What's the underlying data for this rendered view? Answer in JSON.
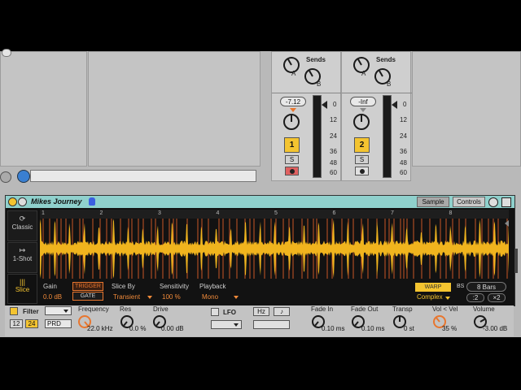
{
  "session": {
    "left_small_button": "",
    "bottom_field": ""
  },
  "mixer": {
    "tracks": [
      {
        "sends_label": "Sends",
        "send_a": "A",
        "send_b": "B",
        "volume": "-7.12",
        "number": "1",
        "solo": "S",
        "color": "#f4c430"
      },
      {
        "sends_label": "Sends",
        "send_a": "A",
        "send_b": "B",
        "volume": "-Inf",
        "number": "2",
        "solo": "S",
        "color": "#f4c430"
      }
    ],
    "db_scale": [
      "0",
      "12",
      "24",
      "36",
      "48",
      "60"
    ]
  },
  "clip": {
    "title": "Mikes Journey",
    "tabs": {
      "sample": "Sample",
      "controls": "Controls"
    },
    "modes": {
      "classic": "Classic",
      "one_shot": "1-Shot",
      "slice": "Slice"
    },
    "ruler": [
      "1",
      "2",
      "3",
      "4",
      "5",
      "6",
      "7",
      "8"
    ],
    "gain_label": "Gain",
    "gain_value": "0.0 dB",
    "trigger": "TRIGGER",
    "gate": "GATE",
    "slice_by_label": "Slice By",
    "slice_by_value": "Transient",
    "sensitivity_label": "Sensitivity",
    "sensitivity_value": "100 %",
    "playback_label": "Playback",
    "playback_value": "Mono",
    "warp": "WARP",
    "bs_label": "BS",
    "bars": "8 Bars",
    "warp_mode": "Complex",
    "half": ":2",
    "double": "×2",
    "colors": {
      "header": "#8fd0cc",
      "waveform": "#f0b41e",
      "markers": "#e8642a",
      "accent": "#f08a3a"
    }
  },
  "controls": {
    "filter_label": "Filter",
    "filter_slopes": [
      "12",
      "24"
    ],
    "filter_type": "PRD",
    "frequency_label": "Frequency",
    "frequency_value": "22.0 kHz",
    "res_label": "Res",
    "res_value": "0.0 %",
    "drive_label": "Drive",
    "drive_value": "0.00 dB",
    "lfo_label": "LFO",
    "hz_label": "Hz",
    "note_symbol": "♪",
    "fade_in_label": "Fade In",
    "fade_in_value": "0.10 ms",
    "fade_out_label": "Fade Out",
    "fade_out_value": "0.10 ms",
    "transp_label": "Transp",
    "transp_value": "0 st",
    "vol_vel_label": "Vol < Vel",
    "vol_vel_value": "35 %",
    "volume_label": "Volume",
    "volume_value": "-3.00 dB"
  }
}
